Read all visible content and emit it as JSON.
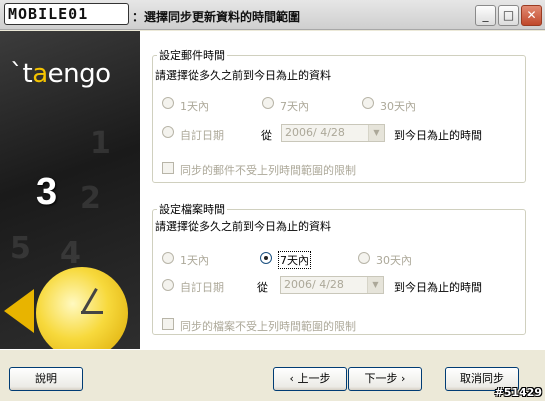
{
  "titlebar": {
    "logo": "MOBILE01",
    "title": "：選擇同步更新資料的時間範圍",
    "minimize": "_",
    "maximize": "□",
    "close": "✕"
  },
  "sidebar": {
    "brand_prefix": "`t",
    "brand_a": "a",
    "brand_rest": "engo",
    "step": "3"
  },
  "mail_group": {
    "legend": "設定郵件時間",
    "prompt": "請選擇從多久之前到今日為止的資料",
    "option_1day": "1天內",
    "option_7day": "7天內",
    "option_30day": "30天內",
    "option_custom": "自訂日期",
    "from_label": "從",
    "date_value": "2006/ 4/28",
    "to_label": "到今日為止的時間",
    "checkbox_label": "同步的郵件不受上列時間範圍的限制"
  },
  "file_group": {
    "legend": "設定檔案時間",
    "prompt": "請選擇從多久之前到今日為止的資料",
    "option_1day": "1天內",
    "option_7day": "7天內",
    "option_30day": "30天內",
    "option_custom": "自訂日期",
    "from_label": "從",
    "date_value": "2006/ 4/28",
    "to_label": "到今日為止的時間",
    "checkbox_label": "同步的檔案不受上列時間範圍的限制",
    "selected": "7天內"
  },
  "buttons": {
    "help": "說明",
    "back": "‹ 上一步",
    "next": "下一步 ›",
    "cancel": "取消同步"
  },
  "watermark": "#51429"
}
